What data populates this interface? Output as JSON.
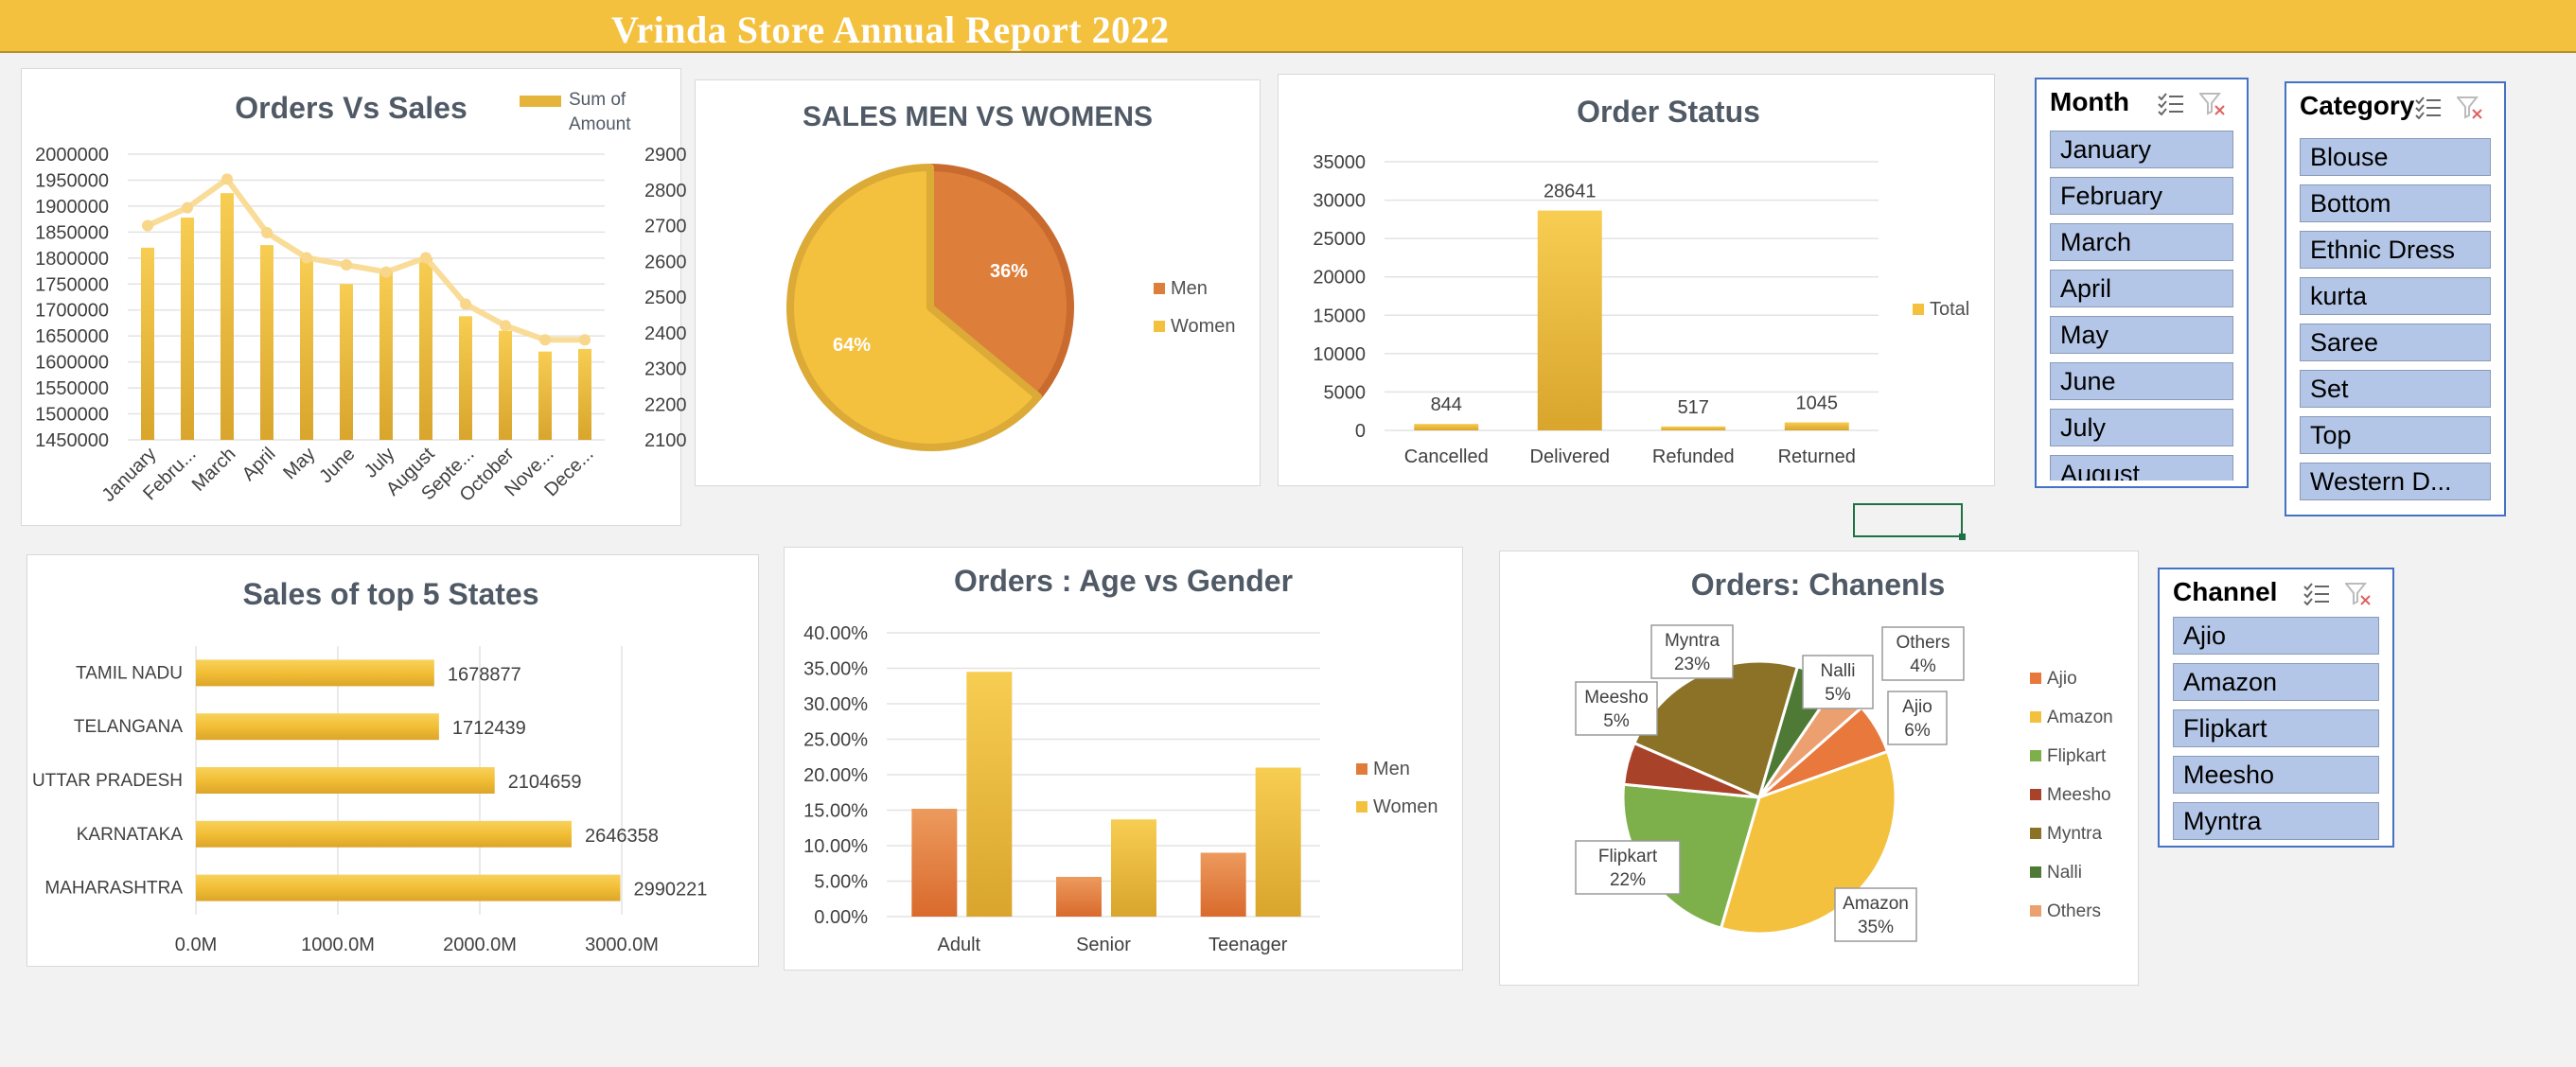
{
  "report_title": "Vrinda Store Annual Report 2022",
  "colors": {
    "banner": "#f4c13f",
    "gold": "#f4c13f",
    "orange": "#e07b39",
    "slicer_item": "#b4c6e7",
    "slicer_border": "#4472c4"
  },
  "chart_data": [
    {
      "id": "orders-vs-sales",
      "type": "bar",
      "title": "Orders Vs Sales",
      "categories": [
        "January",
        "Febru...",
        "March",
        "April",
        "May",
        "June",
        "July",
        "August",
        "Septe...",
        "October",
        "Nove...",
        "Dece..."
      ],
      "series": [
        {
          "name": "Sum of Amount",
          "type": "bar",
          "axis": "left",
          "values": [
            1820000,
            1878000,
            1925000,
            1825000,
            1800000,
            1750000,
            1775000,
            1800000,
            1688000,
            1660000,
            1620000,
            1625000
          ]
        },
        {
          "type": "line",
          "axis": "right",
          "values": [
            2700,
            2750,
            2830,
            2680,
            2610,
            2590,
            2570,
            2610,
            2480,
            2420,
            2380,
            2380
          ]
        }
      ],
      "y_left": {
        "min": 1450000,
        "max": 2000000,
        "ticks": [
          "2000000",
          "1950000",
          "1900000",
          "1850000",
          "1800000",
          "1750000",
          "1700000",
          "1650000",
          "1600000",
          "1550000",
          "1500000",
          "1450000"
        ]
      },
      "y_right": {
        "min": 2100,
        "max": 2900,
        "ticks": [
          "2900",
          "2800",
          "2700",
          "2600",
          "2500",
          "2400",
          "2300",
          "2200",
          "2100"
        ]
      },
      "legend_lines": [
        "Sum of",
        "Amount"
      ],
      "legend": "top-right",
      "grid": true
    },
    {
      "id": "sales-men-vs-women",
      "type": "pie",
      "title": "SALES MEN VS WOMENS",
      "labels": [
        "Men",
        "Women"
      ],
      "values": [
        36,
        64
      ],
      "value_labels": [
        "36%",
        "64%"
      ],
      "legend": "right"
    },
    {
      "id": "order-status",
      "type": "bar",
      "title": "Order Status",
      "categories": [
        "Cancelled",
        "Delivered",
        "Refunded",
        "Returned"
      ],
      "series": [
        {
          "name": "Total",
          "values": [
            844,
            28641,
            517,
            1045
          ]
        }
      ],
      "value_labels": [
        "844",
        "28641",
        "517",
        "1045"
      ],
      "y": {
        "min": 0,
        "max": 35000,
        "ticks": [
          "35000",
          "30000",
          "25000",
          "20000",
          "15000",
          "10000",
          "5000",
          "0"
        ]
      },
      "legend": "right",
      "grid": true
    },
    {
      "id": "top-5-states",
      "type": "bar",
      "orientation": "horizontal",
      "title": "Sales of top 5 States",
      "categories": [
        "TAMIL NADU",
        "TELANGANA",
        "UTTAR PRADESH",
        "KARNATAKA",
        "MAHARASHTRA"
      ],
      "values": [
        1678877,
        1712439,
        2104659,
        2646358,
        2990221
      ],
      "value_labels": [
        "1678877",
        "1712439",
        "2104659",
        "2646358",
        "2990221"
      ],
      "x": {
        "min": 0,
        "max": 3000000,
        "ticks": [
          "0.0M",
          "1000.0M",
          "2000.0M",
          "3000.0M"
        ]
      },
      "grid": true
    },
    {
      "id": "age-vs-gender",
      "type": "bar",
      "title": "Orders : Age vs Gender",
      "categories": [
        "Adult",
        "Senior",
        "Teenager"
      ],
      "series": [
        {
          "name": "Men",
          "values": [
            15.2,
            5.6,
            9.0
          ]
        },
        {
          "name": "Women",
          "values": [
            34.5,
            13.7,
            21.0
          ]
        }
      ],
      "y": {
        "min": 0,
        "max": 40,
        "ticks": [
          "40.00%",
          "35.00%",
          "30.00%",
          "25.00%",
          "20.00%",
          "15.00%",
          "10.00%",
          "5.00%",
          "0.00%"
        ]
      },
      "legend": "right",
      "grid": true
    },
    {
      "id": "orders-channels",
      "type": "pie",
      "title": "Orders: Chanenls",
      "labels": [
        "Ajio",
        "Amazon",
        "Flipkart",
        "Meesho",
        "Myntra",
        "Nalli",
        "Others"
      ],
      "values": [
        6,
        35,
        22,
        5,
        23,
        5,
        4
      ],
      "value_labels": [
        "6%",
        "35%",
        "22%",
        "5%",
        "23%",
        "5%",
        "4%"
      ],
      "legend": "right"
    }
  ],
  "slicers": {
    "month": {
      "header": "Month",
      "items": [
        "January",
        "February",
        "March",
        "April",
        "May",
        "June",
        "July",
        "August"
      ]
    },
    "category": {
      "header": "Category",
      "items": [
        "Blouse",
        "Bottom",
        "Ethnic Dress",
        "kurta",
        "Saree",
        "Set",
        "Top",
        "Western D..."
      ]
    },
    "channel": {
      "header": "Channel",
      "items": [
        "Ajio",
        "Amazon",
        "Flipkart",
        "Meesho",
        "Myntra"
      ]
    }
  },
  "icons": {
    "multiselect": "multi-select-icon",
    "clear_filter": "clear-filter-icon"
  }
}
